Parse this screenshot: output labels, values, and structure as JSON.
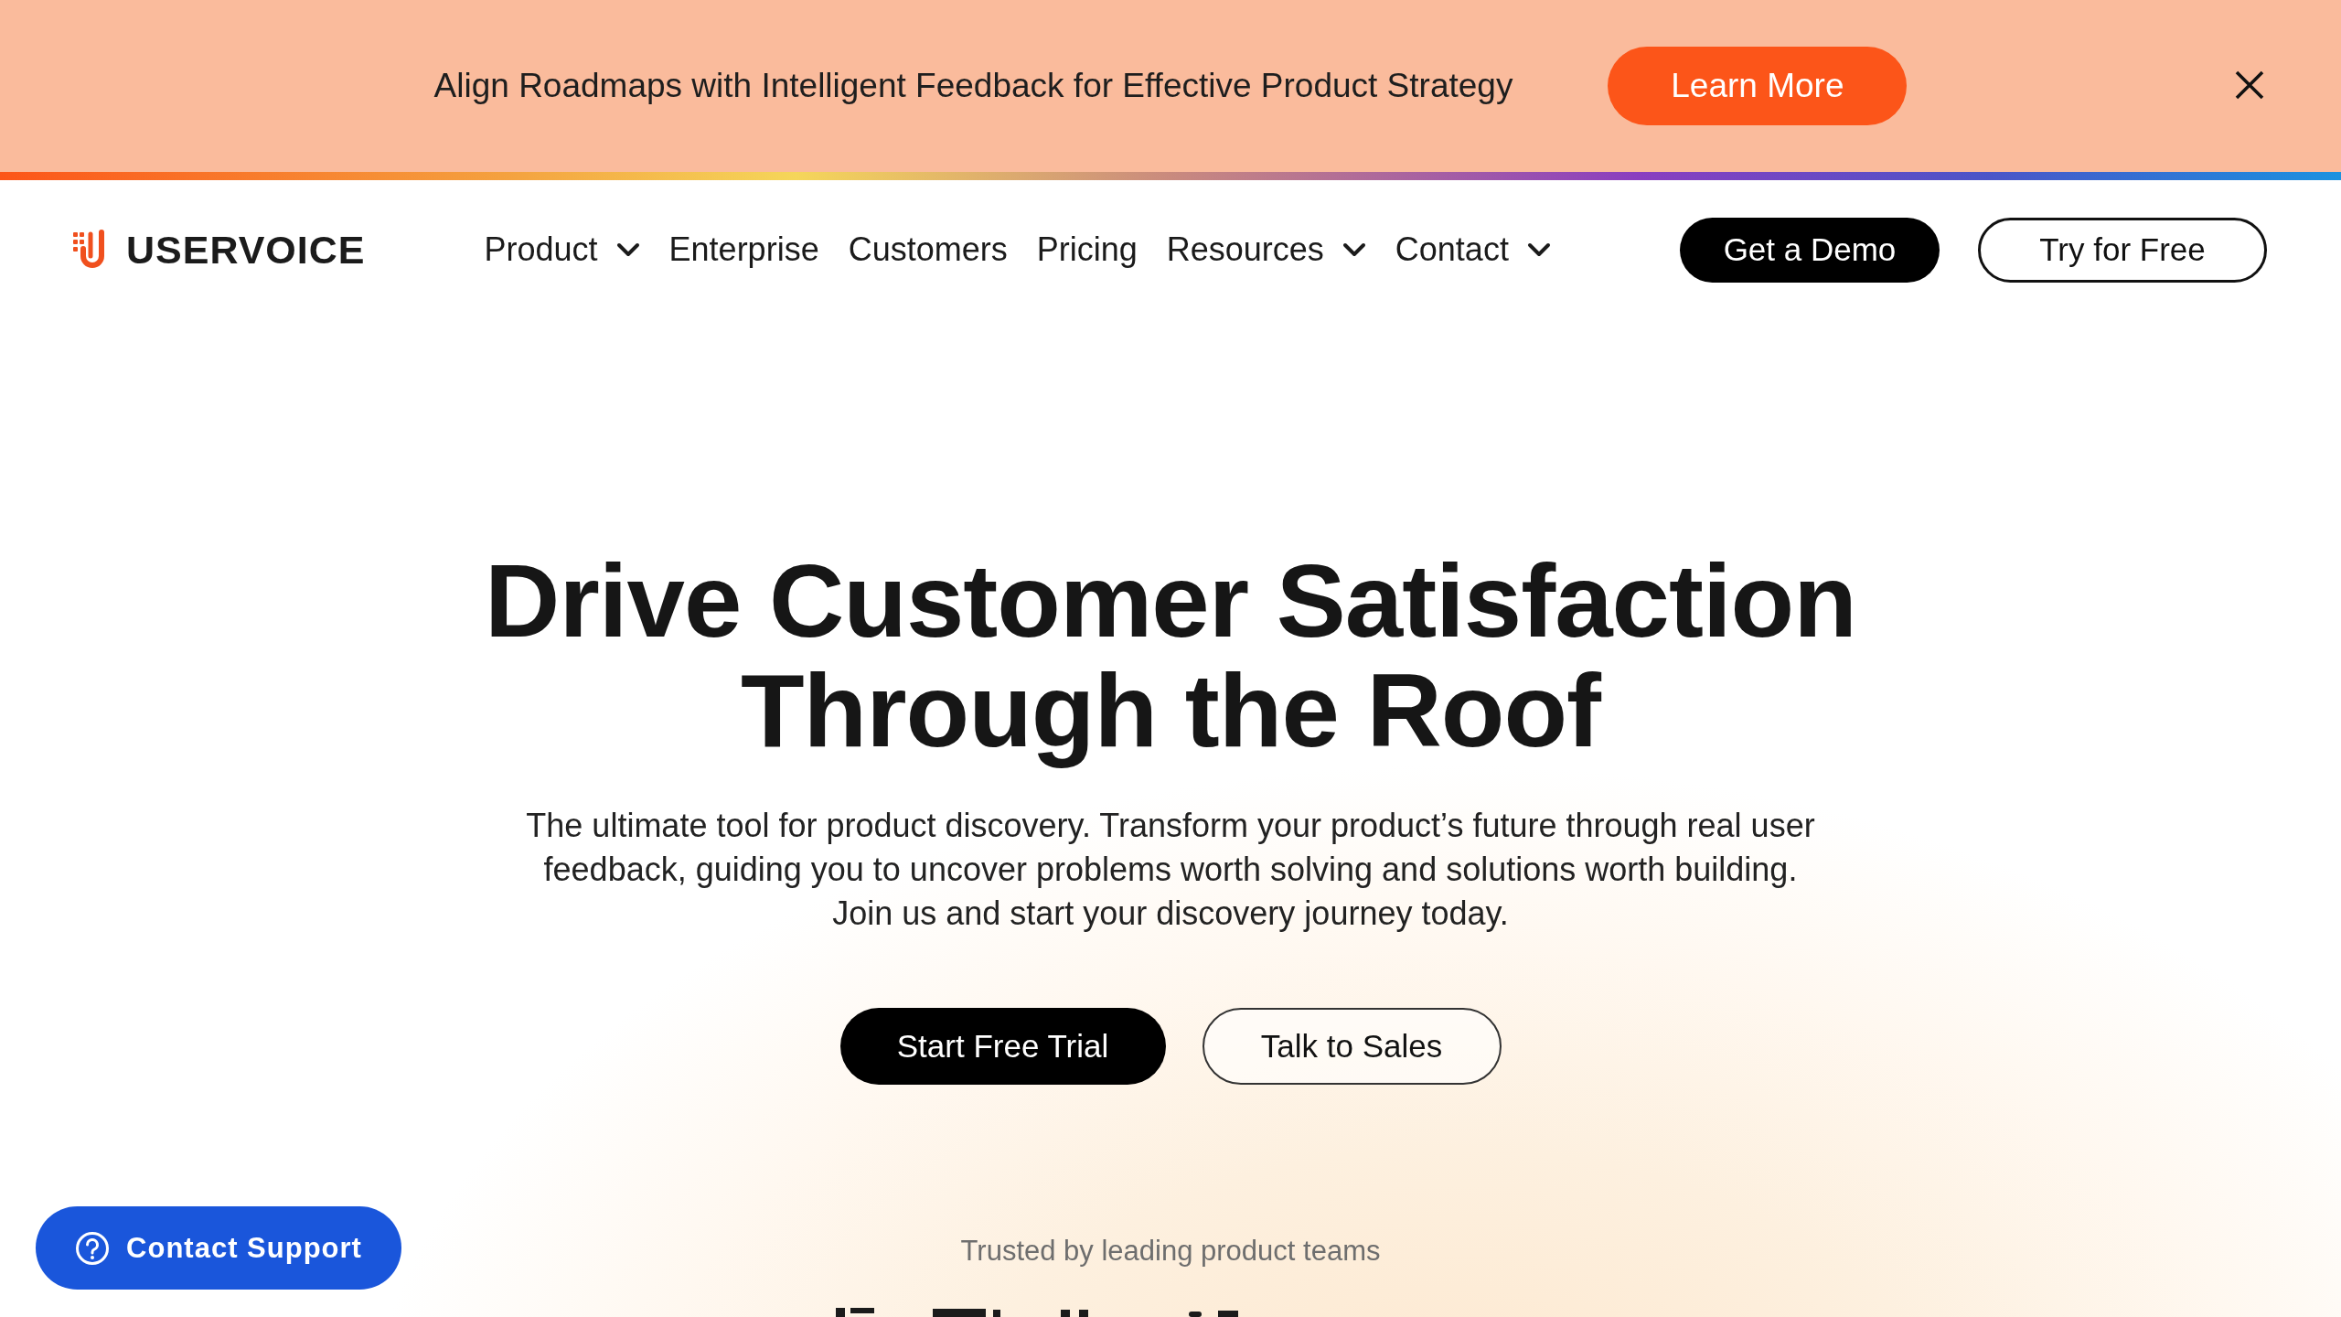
{
  "announcement_bar": {
    "text": "Align Roadmaps with Intelligent Feedback for Effective Product Strategy",
    "button": "Learn More"
  },
  "header": {
    "logo": "USERVOICE",
    "nav": [
      {
        "label": "Product",
        "has_menu": true
      },
      {
        "label": "Enterprise",
        "has_menu": false
      },
      {
        "label": "Customers",
        "has_menu": false
      },
      {
        "label": "Pricing",
        "has_menu": false
      },
      {
        "label": "Resources",
        "has_menu": true
      },
      {
        "label": "Contact",
        "has_menu": true
      }
    ],
    "buttons": [
      {
        "label": "Get a Demo",
        "kind": "filled"
      },
      {
        "label": "Try for Free",
        "kind": "outline"
      }
    ]
  },
  "hero": {
    "title": "Drive Customer Satisfaction\nThrough the Roof",
    "description": "The ultimate tool for product discovery. Transform your product’s future through real user\nfeedback, guiding you to uncover problems worth solving and solutions worth building.\nJoin us and start your discovery journey today.",
    "buttons": [
      {
        "label": "Start Free Trial",
        "kind": "filled"
      },
      {
        "label": "Talk to Sales",
        "kind": "outline"
      }
    ],
    "trusted_label": "Trusted by leading product teams"
  },
  "support_button": {
    "label": "Contact Support"
  }
}
